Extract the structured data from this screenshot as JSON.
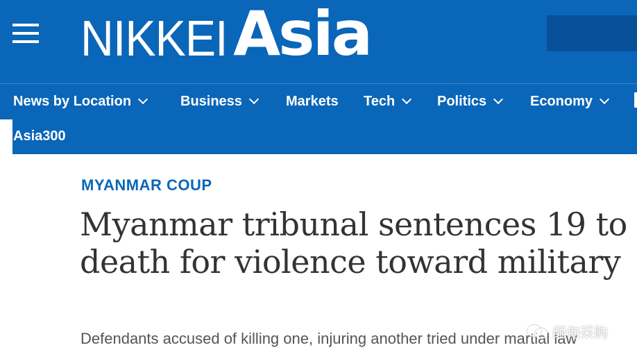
{
  "header": {
    "logo_nikkei": "NIKKEI",
    "logo_asia": "Asia"
  },
  "nav": {
    "items": [
      {
        "label": "News by Location",
        "has_dropdown": true
      },
      {
        "label": "Business",
        "has_dropdown": true
      },
      {
        "label": "Markets",
        "has_dropdown": false
      },
      {
        "label": "Tech",
        "has_dropdown": true
      },
      {
        "label": "Politics",
        "has_dropdown": true
      },
      {
        "label": "Economy",
        "has_dropdown": true
      },
      {
        "label": "Asia300",
        "has_dropdown": false
      }
    ]
  },
  "article": {
    "section": "MYANMAR COUP",
    "headline": "Myanmar tribunal sentences 19 to death for violence toward military",
    "subheadline": "Defendants accused of killing one, injuring another tried under martial law"
  },
  "watermark": {
    "text": "缅甸采购",
    "icon": "wechat-icon"
  },
  "colors": {
    "brand_blue": "#0a66b8",
    "search_block": "#08509a",
    "headline_text": "#333333",
    "section_label": "#0a66b8"
  }
}
